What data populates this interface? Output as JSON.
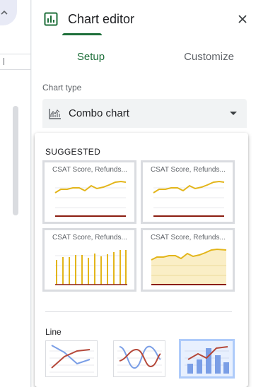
{
  "panel": {
    "title": "Chart editor",
    "tabs": [
      {
        "label": "Setup",
        "active": true
      },
      {
        "label": "Customize",
        "active": false
      }
    ],
    "chart_type_label": "Chart type",
    "chart_type_value": "Combo chart"
  },
  "dropdown": {
    "suggested_heading": "SUGGESTED",
    "thumbnails": [
      {
        "title": "CSAT Score, Refunds..."
      },
      {
        "title": "CSAT Score, Refunds..."
      },
      {
        "title": "CSAT Score, Refunds..."
      },
      {
        "title": "CSAT Score, Refunds..."
      }
    ],
    "line_heading": "Line"
  },
  "colors": {
    "accent": "#1e6f3a",
    "series_gold": "#e3b51a",
    "series_dark_red": "#8b1d10",
    "line_blue": "#7a9ee6",
    "line_red": "#b5483a",
    "selection_blue": "#aecbfa"
  }
}
